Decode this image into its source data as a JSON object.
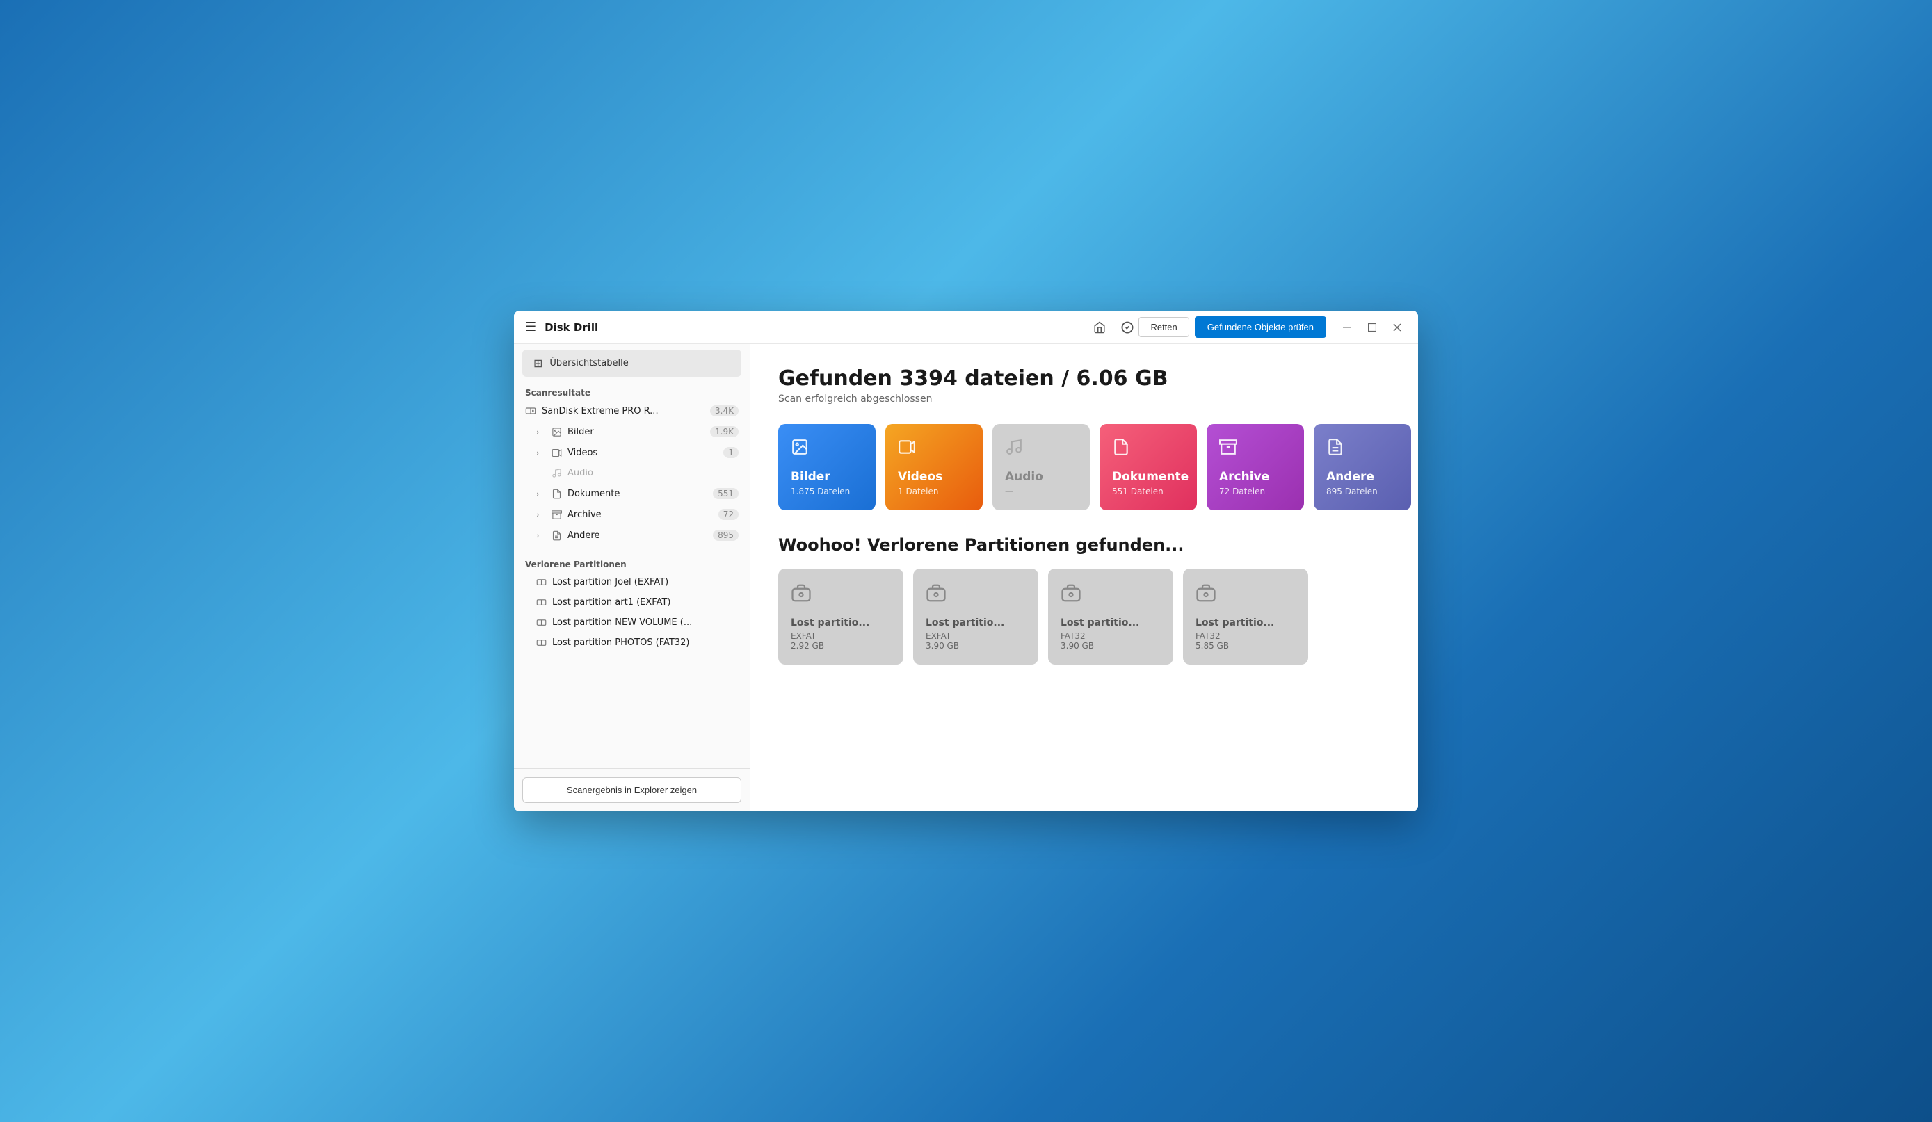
{
  "app": {
    "title": "Disk Drill"
  },
  "titlebar": {
    "home_icon": "🏠",
    "check_icon": "✓",
    "retten_label": "Retten",
    "primary_button_label": "Gefundene Objekte prüfen",
    "minimize_icon": "—",
    "maximize_icon": "□",
    "close_icon": "✕"
  },
  "sidebar": {
    "overview_label": "Übersichtstabelle",
    "scan_results_label": "Scanresultate",
    "disk_item": {
      "label": "SanDisk Extreme PRO R...",
      "count": "3.4K"
    },
    "categories": [
      {
        "label": "Bilder",
        "count": "1.9K",
        "expandable": true
      },
      {
        "label": "Videos",
        "count": "1",
        "expandable": true
      },
      {
        "label": "Audio",
        "count": "",
        "expandable": false
      },
      {
        "label": "Dokumente",
        "count": "551",
        "expandable": true
      },
      {
        "label": "Archive",
        "count": "72",
        "expandable": true
      },
      {
        "label": "Andere",
        "count": "895",
        "expandable": true
      }
    ],
    "lost_partitions_label": "Verlorene Partitionen",
    "lost_partitions": [
      {
        "label": "Lost partition Joel (EXFAT)"
      },
      {
        "label": "Lost partition art1 (EXFAT)"
      },
      {
        "label": "Lost partition NEW VOLUME (..."
      },
      {
        "label": "Lost partition PHOTOS (FAT32)"
      }
    ],
    "bottom_button": "Scanergebnis in Explorer zeigen"
  },
  "content": {
    "headline": "Gefunden 3394 dateien / 6.06 GB",
    "subtitle": "Scan erfolgreich abgeschlossen",
    "category_cards": [
      {
        "id": "bilder",
        "title": "Bilder",
        "count": "1.875 Dateien",
        "icon": "🖼️",
        "style": "card-bilder"
      },
      {
        "id": "videos",
        "title": "Videos",
        "count": "1 Dateien",
        "icon": "🎞️",
        "style": "card-videos"
      },
      {
        "id": "audio",
        "title": "Audio",
        "count": "—",
        "icon": "♪",
        "style": "card-audio"
      },
      {
        "id": "dokumente",
        "title": "Dokumente",
        "count": "551 Dateien",
        "icon": "📄",
        "style": "card-dokumente"
      },
      {
        "id": "archive",
        "title": "Archive",
        "count": "72 Dateien",
        "icon": "🗜️",
        "style": "card-archive"
      },
      {
        "id": "andere",
        "title": "Andere",
        "count": "895 Dateien",
        "icon": "📋",
        "style": "card-andere"
      }
    ],
    "lost_partitions_title": "Woohoo! Verlorene Partitionen gefunden...",
    "partition_cards": [
      {
        "title": "Lost partitio...",
        "fs": "EXFAT",
        "size": "2.92 GB"
      },
      {
        "title": "Lost partitio...",
        "fs": "EXFAT",
        "size": "3.90 GB"
      },
      {
        "title": "Lost partitio...",
        "fs": "FAT32",
        "size": "3.90 GB"
      },
      {
        "title": "Lost partitio...",
        "fs": "FAT32",
        "size": "5.85 GB"
      }
    ]
  }
}
